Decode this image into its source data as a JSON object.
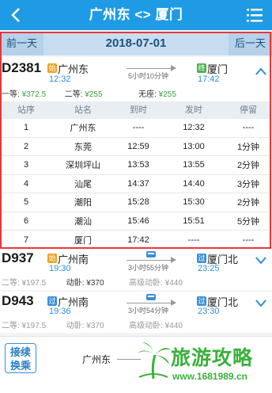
{
  "header": {
    "title": "广州东 <> 厦门"
  },
  "datebar": {
    "prev_label": "前一天",
    "date": "2018-07-01",
    "next_label": "后一天"
  },
  "trains": [
    {
      "number": "D2381",
      "from_badge": "始",
      "from_station": "广州东",
      "depart_time": "12:32",
      "duration": "5小时10分钟",
      "to_badge": "终",
      "to_station": "厦门",
      "arrive_time": "17:42",
      "seat1": "一等: ",
      "seat1_price": "¥372.5",
      "seat2": "二等: ",
      "seat2_price": "¥255",
      "seat3": "无座: ",
      "seat3_price": "¥255"
    },
    {
      "number": "D937",
      "from_badge": "始",
      "from_station": "广州南",
      "depart_time": "19:30",
      "duration": "3小时55分钟",
      "to_badge": "过",
      "to_station": "厦门北",
      "arrive_time": "23:25",
      "seat1": "二等: ",
      "seat1_price": "¥197.5",
      "seat2": "动卧: ",
      "seat2_price": "¥370",
      "seat3": "高级动卧: ",
      "seat3_price": "¥440"
    },
    {
      "number": "D943",
      "from_badge": "过",
      "from_station": "广州南",
      "depart_time": "19:36",
      "duration": "3小时54分钟",
      "to_badge": "过",
      "to_station": "厦门北",
      "arrive_time": "23:30",
      "seat1": "二等: ",
      "seat1_price": "¥197.5",
      "seat2": "动卧: ",
      "seat2_price": "¥370",
      "seat3": "高级动卧: ",
      "seat3_price": "¥440"
    }
  ],
  "stops": {
    "headers": [
      "站序",
      "站名",
      "到时",
      "发时",
      "停留"
    ],
    "rows": [
      [
        "1",
        "广州东",
        "----",
        "12:32",
        "----"
      ],
      [
        "2",
        "东莞",
        "12:59",
        "13:00",
        "1分钟"
      ],
      [
        "3",
        "深圳坪山",
        "13:53",
        "13:55",
        "2分钟"
      ],
      [
        "4",
        "汕尾",
        "14:37",
        "14:40",
        "3分钟"
      ],
      [
        "5",
        "潮阳",
        "15:28",
        "15:30",
        "2分钟"
      ],
      [
        "6",
        "潮汕",
        "15:46",
        "15:51",
        "5分钟"
      ],
      [
        "7",
        "厦门",
        "17:42",
        "----",
        "----"
      ]
    ]
  },
  "bottom": {
    "transfer_line1": "接续",
    "transfer_line2": "换乘",
    "from_station": "广州东"
  },
  "watermark": {
    "text": "旅游攻略",
    "url": "www.1681989.cn"
  },
  "colors": {
    "header": "#1e9be4",
    "highlight": "#e8383b",
    "price_green": "#3aa043",
    "time_blue": "#2a8fd8"
  }
}
